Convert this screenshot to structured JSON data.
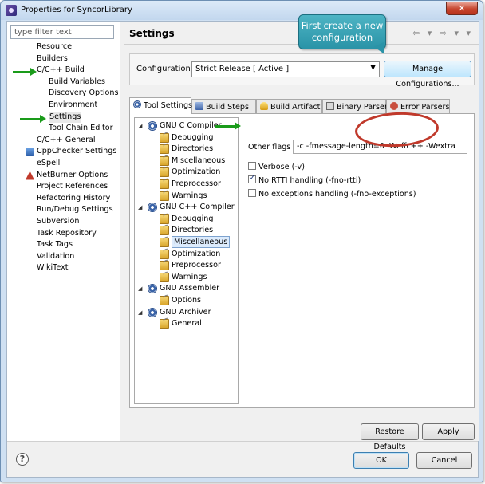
{
  "window": {
    "title": "Properties for SyncorLibrary",
    "close_label": "✕"
  },
  "sidebar": {
    "filter_placeholder": "type filter text",
    "items": [
      {
        "label": "Resource",
        "indent": 0
      },
      {
        "label": "Builders",
        "indent": 0
      },
      {
        "label": "C/C++ Build",
        "indent": 0,
        "expanded": true
      },
      {
        "label": "Build Variables",
        "indent": 1
      },
      {
        "label": "Discovery Options",
        "indent": 1
      },
      {
        "label": "Environment",
        "indent": 1
      },
      {
        "label": "Settings",
        "indent": 1,
        "selected": true
      },
      {
        "label": "Tool Chain Editor",
        "indent": 1
      },
      {
        "label": "C/C++ General",
        "indent": 0
      },
      {
        "label": "CppChecker Settings",
        "indent": 0,
        "icon": "cppchecker-icon"
      },
      {
        "label": "eSpell",
        "indent": 0
      },
      {
        "label": "NetBurner Options",
        "indent": 0,
        "icon": "netburner-icon"
      },
      {
        "label": "Project References",
        "indent": 0
      },
      {
        "label": "Refactoring History",
        "indent": 0
      },
      {
        "label": "Run/Debug Settings",
        "indent": 0
      },
      {
        "label": "Subversion",
        "indent": 0
      },
      {
        "label": "Task Repository",
        "indent": 0
      },
      {
        "label": "Task Tags",
        "indent": 0
      },
      {
        "label": "Validation",
        "indent": 0
      },
      {
        "label": "WikiText",
        "indent": 0
      }
    ]
  },
  "main": {
    "title": "Settings",
    "configuration": {
      "label": "Configuration:",
      "value": "Strict Release  [ Active ]",
      "manage_button": "Manage Configurations..."
    },
    "tabs": [
      {
        "label": "Tool Settings",
        "active": true
      },
      {
        "label": "Build Steps"
      },
      {
        "label": "Build Artifact"
      },
      {
        "label": "Binary Parsers"
      },
      {
        "label": "Error Parsers"
      }
    ],
    "tool_tree": [
      {
        "label": "GNU C Compiler",
        "level": 0,
        "type": "tool"
      },
      {
        "label": "Debugging",
        "level": 1,
        "type": "option"
      },
      {
        "label": "Directories",
        "level": 1,
        "type": "option"
      },
      {
        "label": "Miscellaneous",
        "level": 1,
        "type": "option"
      },
      {
        "label": "Optimization",
        "level": 1,
        "type": "option"
      },
      {
        "label": "Preprocessor",
        "level": 1,
        "type": "option"
      },
      {
        "label": "Warnings",
        "level": 1,
        "type": "option"
      },
      {
        "label": "GNU C++ Compiler",
        "level": 0,
        "type": "tool"
      },
      {
        "label": "Debugging",
        "level": 1,
        "type": "option"
      },
      {
        "label": "Directories",
        "level": 1,
        "type": "option"
      },
      {
        "label": "Miscellaneous",
        "level": 1,
        "type": "option",
        "selected": true
      },
      {
        "label": "Optimization",
        "level": 1,
        "type": "option"
      },
      {
        "label": "Preprocessor",
        "level": 1,
        "type": "option"
      },
      {
        "label": "Warnings",
        "level": 1,
        "type": "option"
      },
      {
        "label": "GNU Assembler",
        "level": 0,
        "type": "tool"
      },
      {
        "label": "Options",
        "level": 1,
        "type": "option"
      },
      {
        "label": "GNU Archiver",
        "level": 0,
        "type": "tool"
      },
      {
        "label": "General",
        "level": 1,
        "type": "option"
      }
    ],
    "other_flags": {
      "label": "Other flags",
      "value": "-c -fmessage-length=0 -Weffc++ -Wextra"
    },
    "checkboxes": [
      {
        "label": "Verbose (-v)",
        "checked": false
      },
      {
        "label": "No RTTI handling (-fno-rtti)",
        "checked": true
      },
      {
        "label": "No exceptions handling (-fno-exceptions)",
        "checked": false
      }
    ],
    "restore_defaults": "Restore Defaults",
    "apply": "Apply"
  },
  "footer": {
    "help": "?",
    "ok": "OK",
    "cancel": "Cancel"
  },
  "annotation": {
    "callout_line1": "First create a new",
    "callout_line2": "configuration",
    "arrow_color": "#1a9b1a",
    "oval_color": "#c0392b"
  },
  "nav_arrows": "⇦ ▾ ⇨ ▾ ▾"
}
